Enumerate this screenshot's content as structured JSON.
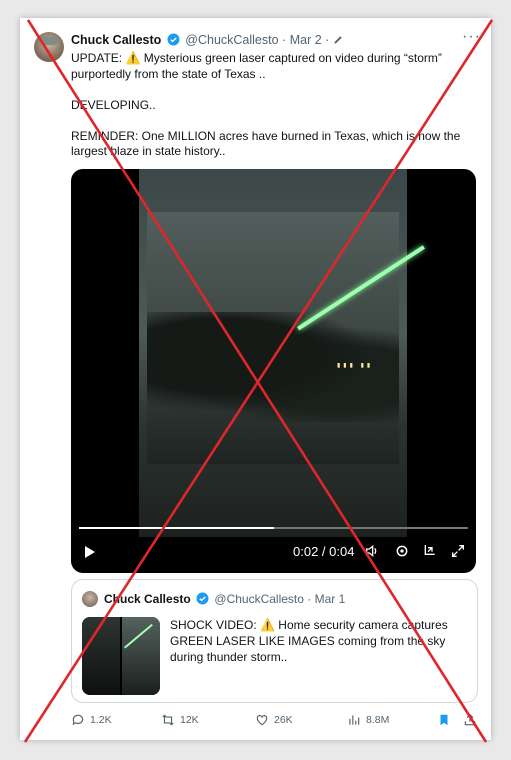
{
  "tweet": {
    "author_name": "Chuck Callesto",
    "handle": "@ChuckCallesto",
    "date": "Mar 2",
    "separator": "·",
    "more": "···",
    "lines": [
      "UPDATE:  ⚠️  Mysterious green laser captured on video during “storm” purportedly from the state of Texas ..",
      "DEVELOPING..",
      "REMINDER: One MILLION acres have burned in Texas, which is now the largest blaze in state history.."
    ]
  },
  "video": {
    "time": "0:02 / 0:04",
    "progress": 0.5,
    "icons": [
      "play-icon",
      "volume-icon",
      "settings-icon",
      "popout-icon",
      "fullscreen-icon"
    ]
  },
  "quote": {
    "author_name": "Chuck Callesto",
    "handle": "@ChuckCallesto",
    "date": "Mar 1",
    "separator": "·",
    "text": "SHOCK VIDEO: ⚠️  Home security camera captures GREEN LASER LIKE IMAGES coming from the sky during thunder storm.."
  },
  "actions": {
    "replies": "1.2K",
    "reposts": "12K",
    "likes": "26K",
    "views": "8.8M"
  },
  "colors": {
    "accent": "#1d9bf0",
    "cross": "#e0262a",
    "laser": "#9effb0"
  }
}
